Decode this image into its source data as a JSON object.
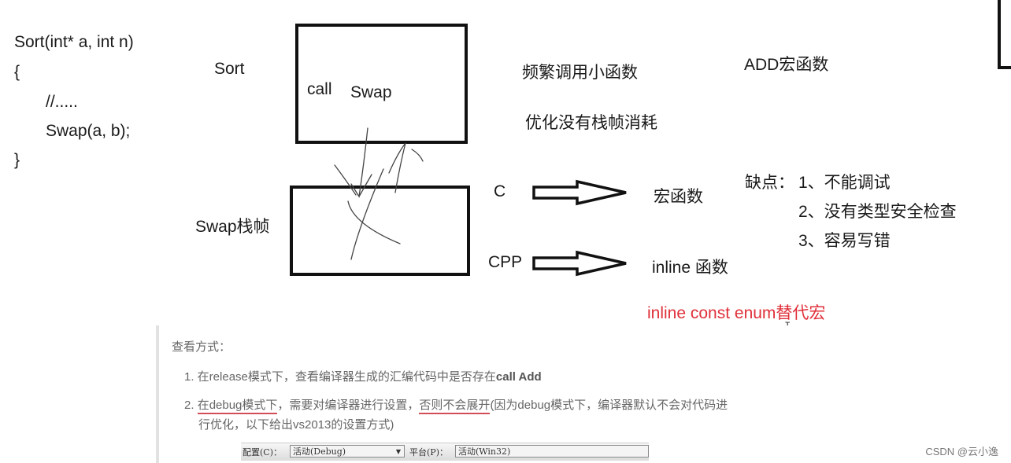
{
  "code": {
    "lines": [
      "Sort(int* a, int n)",
      "{",
      "//.....",
      "Swap(a, b);",
      "}"
    ]
  },
  "diagram": {
    "sort_label": "Sort",
    "call_label": "call",
    "swap_label": "Swap",
    "swap_frame_label": "Swap栈帧"
  },
  "notes": {
    "frequent_small": "频繁调用小函数",
    "optimize": "优化没有栈帧消耗",
    "add_macro": "ADD宏函数",
    "c_label": "C",
    "c_target": "宏函数",
    "cpp_label": "CPP",
    "cpp_target": "inline 函数",
    "drawbacks_title": "缺点：",
    "drawbacks": [
      "1、不能调试",
      "2、没有类型安全检查",
      "3、容易写错"
    ],
    "replace": "inline  const  enum替代宏",
    "cursor": "I"
  },
  "quote": {
    "heading": "查看方式：",
    "item1_prefix": "1. 在release模式下，查看编译器生成的汇编代码中是否存在",
    "item1_bold": "call Add",
    "item2_num": "2. ",
    "item2_u1": "在debug模式下",
    "item2_mid": "，需要对编译器进行设置，",
    "item2_u2": "否则不会展开",
    "item2_rest": "(因为debug模式下，编译器默认不会对代码进",
    "item2_line2": "行优化，以下给出vs2013的设置方式)"
  },
  "toolbar": {
    "config_label": "配置(C)：",
    "config_value": "活动(Debug)",
    "platform_label": "平台(P)：",
    "platform_value": "活动(Win32)"
  },
  "watermark": "CSDN @云小逸",
  "colors": {
    "accent_red": "#e0303a",
    "underline": "#d24d57"
  }
}
